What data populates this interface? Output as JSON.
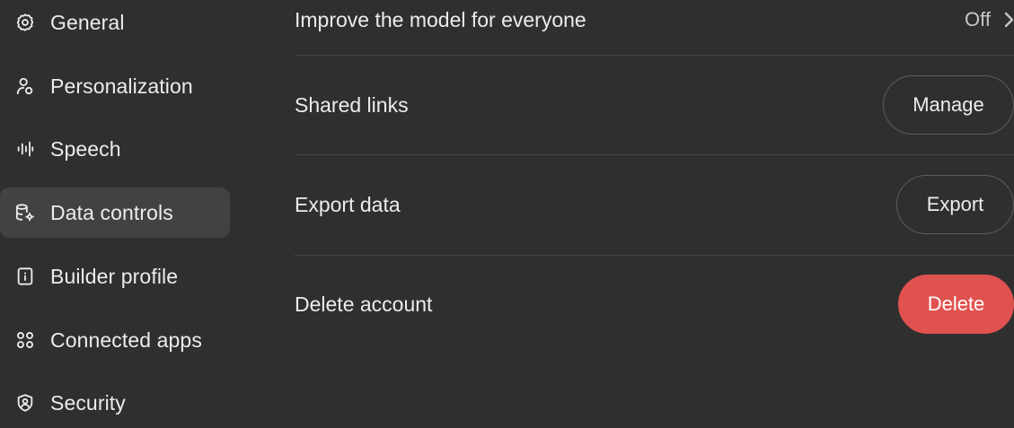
{
  "sidebar": {
    "items": [
      {
        "label": "General",
        "icon": "gear-icon"
      },
      {
        "label": "Personalization",
        "icon": "person-icon"
      },
      {
        "label": "Speech",
        "icon": "waveform-icon"
      },
      {
        "label": "Data controls",
        "icon": "database-gear-icon",
        "active": true
      },
      {
        "label": "Builder profile",
        "icon": "id-card-icon"
      },
      {
        "label": "Connected apps",
        "icon": "apps-grid-icon"
      },
      {
        "label": "Security",
        "icon": "shield-icon"
      }
    ]
  },
  "settings": {
    "improve_model": {
      "label": "Improve the model for everyone",
      "value": "Off"
    },
    "shared_links": {
      "label": "Shared links",
      "button": "Manage"
    },
    "export_data": {
      "label": "Export data",
      "button": "Export"
    },
    "delete_account": {
      "label": "Delete account",
      "button": "Delete"
    }
  },
  "colors": {
    "background": "#2f2f2f",
    "active_item": "#424242",
    "danger": "#e0524f",
    "text": "#ececec",
    "divider": "#444444"
  }
}
